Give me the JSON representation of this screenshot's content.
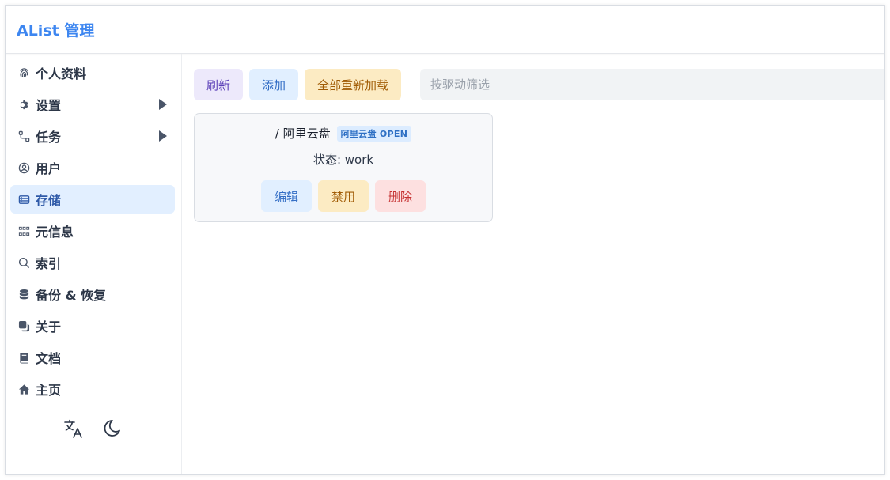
{
  "header": {
    "title": "AList 管理"
  },
  "sidebar": {
    "items": [
      {
        "label": "个人资料",
        "icon": "fingerprint-icon"
      },
      {
        "label": "设置",
        "icon": "gear-icon",
        "expandable": true
      },
      {
        "label": "任务",
        "icon": "flow-icon",
        "expandable": true
      },
      {
        "label": "用户",
        "icon": "user-circle-icon"
      },
      {
        "label": "存储",
        "icon": "storage-icon",
        "active": true
      },
      {
        "label": "元信息",
        "icon": "meta-icon"
      },
      {
        "label": "索引",
        "icon": "search-icon"
      },
      {
        "label": "备份 & 恢复",
        "icon": "database-icon"
      },
      {
        "label": "关于",
        "icon": "copy-icon"
      },
      {
        "label": "文档",
        "icon": "book-icon"
      },
      {
        "label": "主页",
        "icon": "home-icon"
      }
    ],
    "footer": {
      "language_icon": "translate-icon",
      "theme_icon": "moon-icon"
    }
  },
  "toolbar": {
    "refresh_label": "刷新",
    "add_label": "添加",
    "reload_all_label": "全部重新加载",
    "filter_placeholder": "按驱动筛选"
  },
  "storages": [
    {
      "mount_path": "/ 阿里云盘",
      "driver": "阿里云盘 OPEN",
      "status": "状态: work",
      "edit_label": "编辑",
      "disable_label": "禁用",
      "delete_label": "删除"
    }
  ],
  "colors": {
    "accent": "#3d86f0",
    "active_bg": "#e2efff",
    "purple_btn": "#ede9fb",
    "blue_btn": "#e1efff",
    "yellow_btn": "#fcebc3",
    "red_btn": "#fde0e0"
  }
}
